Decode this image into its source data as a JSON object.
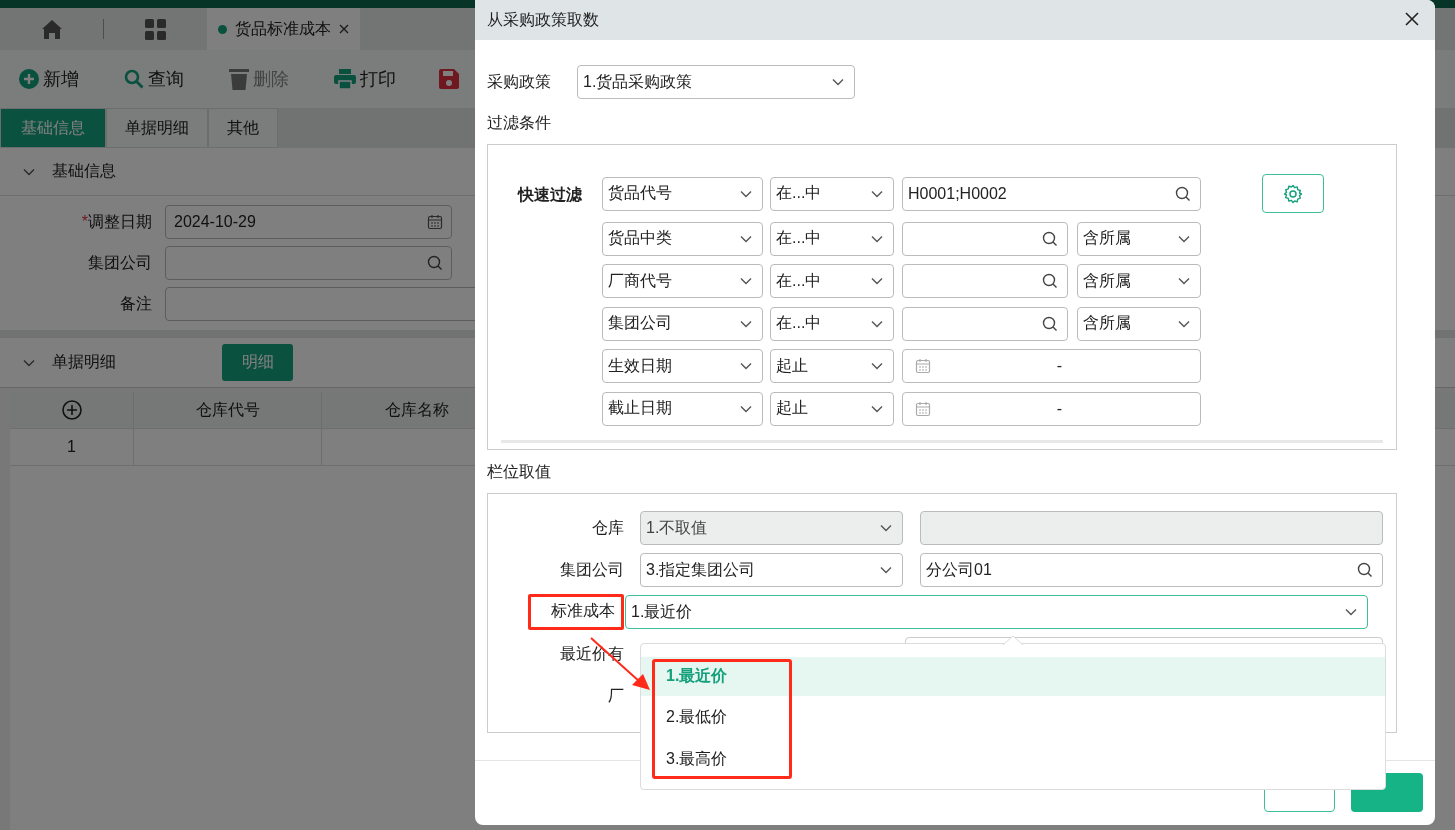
{
  "app": {
    "top_tabs": [
      {
        "kind": "home",
        "selected": false
      },
      {
        "kind": "grid",
        "selected": false
      },
      {
        "kind": "page",
        "label": "货品标准成本",
        "selected": true
      }
    ],
    "toolbar": [
      {
        "kind": "add",
        "label": "新增",
        "disabled": false
      },
      {
        "kind": "query",
        "label": "查询",
        "disabled": false
      },
      {
        "kind": "delete",
        "label": "删除",
        "disabled": true
      },
      {
        "kind": "print",
        "label": "打印",
        "disabled": false
      },
      {
        "kind": "save",
        "disabled": false
      }
    ],
    "tabs": [
      {
        "label": "基础信息",
        "selected": true
      },
      {
        "label": "单据明细",
        "selected": false
      },
      {
        "label": "其他",
        "selected": false
      }
    ],
    "basic_section": {
      "title": "基础信息",
      "expanded": true,
      "fields": [
        {
          "label": "调整日期",
          "required_mark": "*",
          "kind": "date",
          "value": "2024-10-29"
        },
        {
          "label": "集团公司",
          "kind": "search"
        },
        {
          "label": "备注",
          "kind": "wide"
        }
      ]
    },
    "detail_section": {
      "title": "单据明细",
      "expanded": true,
      "button": "明细",
      "columns": [
        "仓库代号",
        "仓库名称"
      ],
      "rows": [
        {
          "index": "1"
        }
      ]
    }
  },
  "dialog": {
    "title": "从采购政策取数",
    "policy": {
      "label": "采购政策",
      "value": "1.货品采购政策"
    },
    "filter_title": "过滤条件",
    "quick_filter_label": "快速过滤",
    "filters": [
      {
        "kind": "search_wide",
        "field": "货品代号",
        "operator": "在...中",
        "value": "H0001;H0002"
      },
      {
        "kind": "search",
        "field": "货品中类",
        "operator": "在...中",
        "include": "含所属"
      },
      {
        "kind": "search",
        "field": "厂商代号",
        "operator": "在...中",
        "include": "含所属"
      },
      {
        "kind": "search",
        "field": "集团公司",
        "operator": "在...中",
        "include": "含所属"
      },
      {
        "kind": "date_range",
        "field": "生效日期",
        "operator": "起止",
        "separator": "-"
      },
      {
        "kind": "date_range",
        "field": "截止日期",
        "operator": "起止",
        "separator": "-"
      }
    ],
    "columns_title": "栏位取值",
    "column_rows": [
      {
        "kind": "plain",
        "label": "仓库",
        "mode": "1.不取值",
        "disabled": true,
        "highlighted": false
      },
      {
        "kind": "search",
        "label": "集团公司",
        "mode": "3.指定集团公司",
        "value": "分公司01",
        "disabled": false,
        "highlighted": false
      },
      {
        "kind": "wide",
        "label": "标准成本",
        "mode": "1.最近价",
        "highlighted": true
      },
      {
        "kind": "hidden",
        "label": "最近价有"
      },
      {
        "kind": "hidden",
        "label": "厂"
      }
    ],
    "dropdown": {
      "highlighted": true,
      "options": [
        {
          "label": "1.最近价",
          "selected": true
        },
        {
          "label": "2.最低价",
          "selected": false
        },
        {
          "label": "3.最高价",
          "selected": false
        }
      ]
    },
    "buttons": [
      {
        "kind": "secondary"
      },
      {
        "kind": "primary"
      }
    ]
  }
}
